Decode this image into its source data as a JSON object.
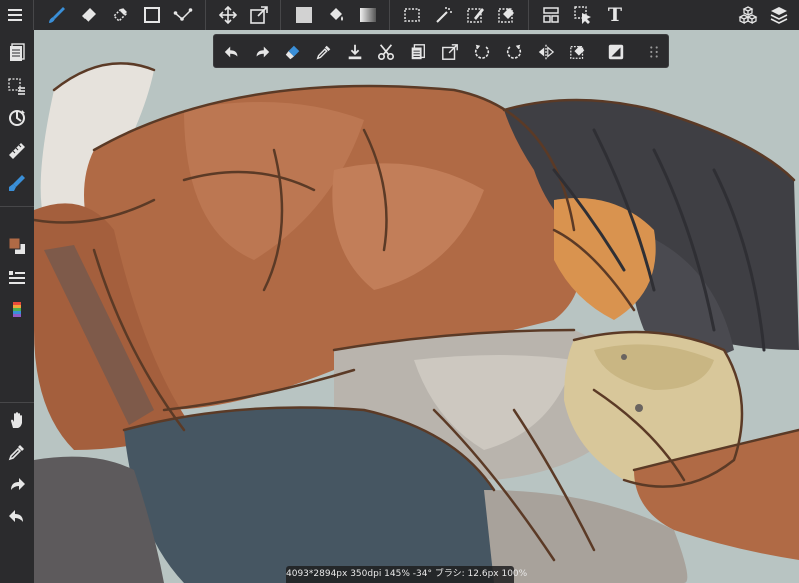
{
  "toolbar": {
    "tools_left": [
      "menu-icon",
      "brush-icon",
      "eraser-icon",
      "lasso-fill-icon",
      "rectangle-icon",
      "vector-line-icon"
    ],
    "tools_mid": [
      "move-icon",
      "transform-icon",
      "fill-color-icon",
      "bucket-icon",
      "gradient-icon"
    ],
    "tools_select": [
      "select-rect-icon",
      "magic-wand-icon",
      "select-pen-icon",
      "select-eraser-icon"
    ],
    "tools_right": [
      "frame-divider-icon",
      "operation-icon",
      "text-icon"
    ],
    "text_tool_label": "T",
    "material_icon": "material-icon",
    "layers_icon": "layers-icon"
  },
  "sidebar": {
    "items": [
      "page-manager-icon",
      "selection-layer-icon",
      "rotate-view-icon",
      "ruler-icon",
      "brush-settings-icon",
      "color-icon",
      "layer-list-icon",
      "color-palette-icon",
      "hand-icon",
      "eyedropper-icon",
      "redo-icon",
      "undo-icon"
    ]
  },
  "floating_toolbar": {
    "items": [
      "undo-icon",
      "redo-icon",
      "clear-icon",
      "eyedropper-icon",
      "save-icon",
      "cut-icon",
      "copy-icon",
      "transform-icon",
      "rotate-left-icon",
      "rotate-right-icon",
      "flip-icon",
      "deselect-icon",
      "invert-icon",
      "grip-icon"
    ]
  },
  "status": {
    "text": "4093*2894px 350dpi 145% -34° ブラシ: 12.6px 100%"
  },
  "colors": {
    "ui_bg": "#2b2b2d",
    "accent": "#3a8fd8",
    "canvas_bg": "#b8c4c2",
    "main_color": "#b06a45"
  }
}
